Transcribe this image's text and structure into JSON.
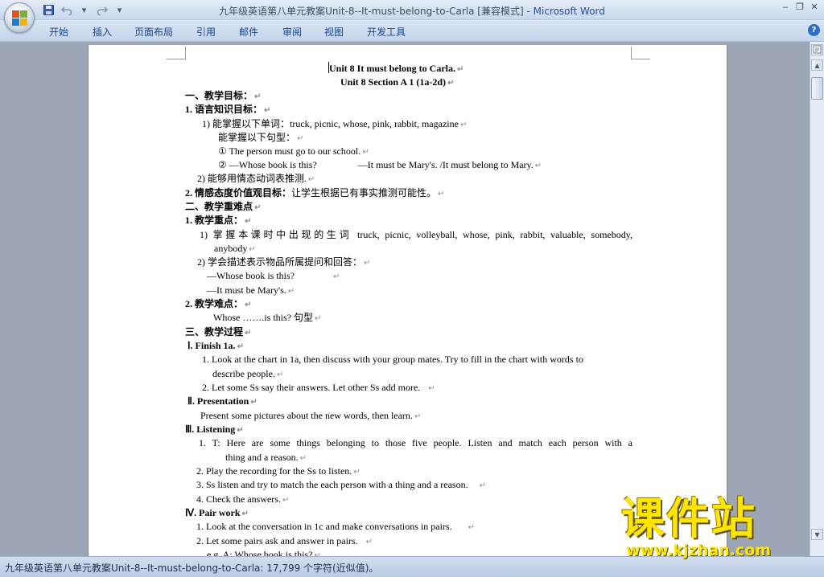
{
  "window": {
    "title": "九年级英语第八单元教案Unit-8--It-must-belong-to-Carla [兼容模式] - ",
    "app_name": "Microsoft Word",
    "accent": "#1f4fa0"
  },
  "qat": {
    "customize_glyph": "▾"
  },
  "ribbon": {
    "tabs": [
      "开始",
      "插入",
      "页面布局",
      "引用",
      "邮件",
      "审阅",
      "视图",
      "开发工具"
    ],
    "help": "?"
  },
  "document": {
    "lines": [
      {
        "text": "Unit 8    It must belong to Carla."
      },
      {
        "text": "Unit 8    Section A 1 (1a-2d)"
      },
      {
        "text": "一、教学目标："
      },
      {
        "text": "1. 语言知识目标："
      },
      {
        "text": "1)  能掌握以下单词：truck, picnic, whose, pink, rabbit, magazine"
      },
      {
        "text": "能掌握以下句型："
      },
      {
        "text": "① The person must go to our school."
      },
      {
        "text": "② —Whose book is this?                 —It must be Mary's. /It must belong to Mary."
      },
      {
        "text": "2)  能够用情态动词表推测."
      },
      {
        "bold": "2. 情感态度价值观目标：",
        "text": "让学生根据已有事实推测可能性。"
      },
      {
        "text": "二、教学重难点"
      },
      {
        "text": "1. 教学重点："
      },
      {
        "text": "1)  掌握本课时中出现的生词 truck, picnic, volleyball, whose, pink, rabbit, valuable, somebody,"
      },
      {
        "text": "anybody"
      },
      {
        "text": "2)  学会描述表示物品所属提问和回答："
      },
      {
        "text": "—Whose book is this?"
      },
      {
        "text": "—It must be Mary's."
      },
      {
        "text": "2. 教学难点："
      },
      {
        "text": "Whose …….is this? 句型"
      },
      {
        "text": "三、教学过程"
      },
      {
        "text": "Ⅰ. Finish 1a."
      },
      {
        "text": "1. Look at the chart in 1a, then discuss with your group mates. Try to fill in the chart with words to"
      },
      {
        "text": "describe people."
      },
      {
        "text": "2. Let some Ss say their answers. Let other Ss add more."
      },
      {
        "text": "Ⅱ. Presentation"
      },
      {
        "text": "Present some pictures about the new words, then learn."
      },
      {
        "text": "Ⅲ. Listening"
      },
      {
        "text": "1.  T:  Here  are  some  things  belonging  to  those  five  people.  Listen  and  match  each  person  with  a"
      },
      {
        "text": "thing and a reason."
      },
      {
        "text": "2. Play the recording for the Ss to listen."
      },
      {
        "text": "3. Ss listen and try to match the each person with a thing and a reason."
      },
      {
        "text": "4. Check the answers."
      },
      {
        "text": "Ⅳ. Pair work"
      },
      {
        "text": "1. Look at the conversation in 1c and make conversations in pairs."
      },
      {
        "text": "2. Let some pairs ask and answer in pairs."
      },
      {
        "text": "e.g. A: Whose book is this?"
      }
    ],
    "paragraph_mark": "↵"
  },
  "statusbar": {
    "text": "九年级英语第八单元教案Unit-8--It-must-belong-to-Carla: 17,799 个字符(近似值)。"
  },
  "watermark": {
    "cn": "课件站",
    "url": "www.kjzhan.com",
    "color": "#ffe600"
  },
  "scrollbar": {
    "up": "▲",
    "down": "▼"
  }
}
